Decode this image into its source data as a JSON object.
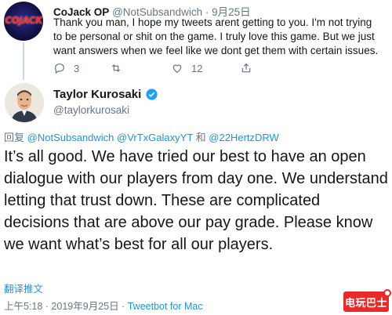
{
  "reply_tweet": {
    "author_name": "CoJack OP",
    "handle": "@NotSubsandwich",
    "separator": "·",
    "date": "9月25日",
    "avatar_text": "COJACK",
    "text": "Thank you man, I hope my tweets arent getting to you. I'm not trying to be personal or shit on the game. I truly love this game. But we just want answers when we feel like we dont get them with certain issues.",
    "reply_count": "3",
    "like_count": "12"
  },
  "main_tweet": {
    "author_name": "Taylor Kurosaki",
    "handle": "@taylorkurosaki",
    "replying_prefix": "回复",
    "mention_1": "@NotSubsandwich",
    "mention_2": "@VrTxGalaxyYT",
    "replying_and": "和",
    "mention_3": "@22HertzDRW",
    "text": "It’s all good. We have tried our best to have an open dialogue with our players from day one. We understand letting that trust down. These are complicated decisions that are above our pay grade. Please know we want what’s best for all our players.",
    "translate_label": "翻译推文",
    "timestamp": "上午5:18 · 2019年9月25日 · ",
    "source": "Tweetbot for Mac"
  },
  "watermark": {
    "text": "电玩巴士",
    "color": "#e82a2a"
  },
  "colors": {
    "link": "#1b95e0",
    "muted": "#657786",
    "text": "#14171a",
    "line": "#ccd6dd"
  },
  "icons": {
    "reply": "reply-icon",
    "retweet": "retweet-icon",
    "like": "heart-icon",
    "share": "share-icon",
    "verified": "verified-badge-icon"
  }
}
